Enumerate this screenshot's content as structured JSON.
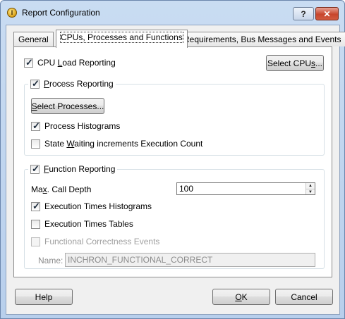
{
  "window": {
    "title": "Report Configuration",
    "help_label": "?",
    "close_label": "✕",
    "app_icon_glyph": "I"
  },
  "tabs": [
    {
      "label": "General",
      "active": false
    },
    {
      "label": "CPUs, Processes and Functions",
      "active": true
    },
    {
      "label": "Requirements, Bus Messages and Events",
      "active": false
    }
  ],
  "cpu": {
    "pre": "CPU ",
    "ul": "L",
    "post": "oad Reporting",
    "checked": true,
    "select_pre": "Select CPU",
    "select_ul": "s",
    "select_post": "..."
  },
  "process": {
    "group_ul": "P",
    "group_post": "rocess Reporting",
    "checked": true,
    "select_pre": "S",
    "select_post": "elect Processes...",
    "histograms_label": "Process Histograms",
    "histograms_checked": true,
    "state_pre": "State ",
    "state_ul": "W",
    "state_post": "aiting increments Execution Count",
    "state_checked": false
  },
  "function": {
    "group_ul": "F",
    "group_post": "unction Reporting",
    "checked": true,
    "depth_pre": "Ma",
    "depth_ul": "x",
    "depth_post": ". Call Depth",
    "depth_value": "100",
    "exec_hist_label": "Execution Times Histograms",
    "exec_hist_checked": true,
    "exec_tables_label": "Execution Times Tables",
    "exec_tables_checked": false,
    "correctness_label": "Functional Correctness Events",
    "correctness_checked": false,
    "name_label": "Name:",
    "name_value": "INCHRON_FUNCTIONAL_CORRECT"
  },
  "buttons": {
    "help": "Help",
    "ok_ul": "O",
    "ok_post": "K",
    "cancel": "Cancel"
  },
  "colors": {
    "titlebar": "#c9dcf2",
    "close": "#c7452c",
    "panel": "#ffffff",
    "dialog": "#f0f0f0"
  }
}
